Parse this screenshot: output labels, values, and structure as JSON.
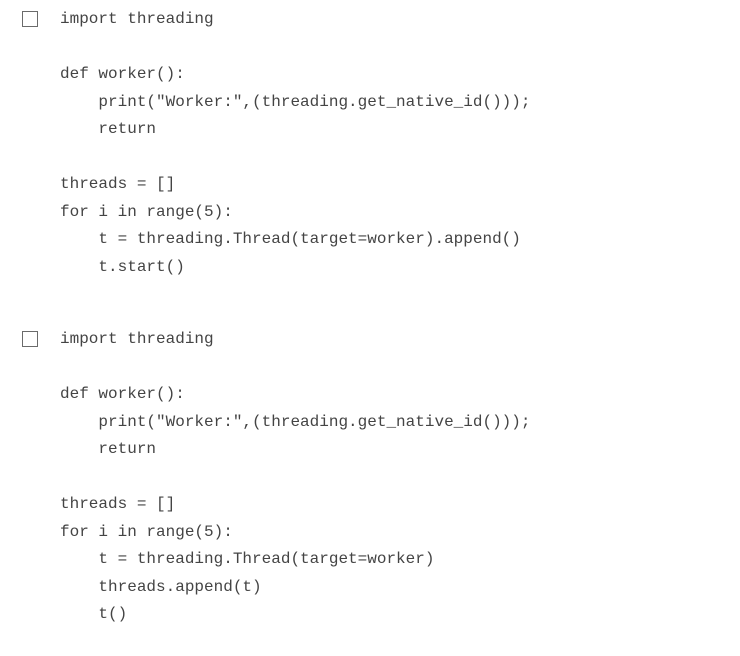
{
  "options": [
    {
      "checked": false,
      "code_lines": [
        "import threading",
        "",
        "def worker():",
        "    print(\"Worker:\",(threading.get_native_id()));",
        "    return",
        "",
        "threads = []",
        "for i in range(5):",
        "    t = threading.Thread(target=worker).append()",
        "    t.start()"
      ]
    },
    {
      "checked": false,
      "code_lines": [
        "import threading",
        "",
        "def worker():",
        "    print(\"Worker:\",(threading.get_native_id()));",
        "    return",
        "",
        "threads = []",
        "for i in range(5):",
        "    t = threading.Thread(target=worker)",
        "    threads.append(t)",
        "    t()"
      ]
    }
  ]
}
